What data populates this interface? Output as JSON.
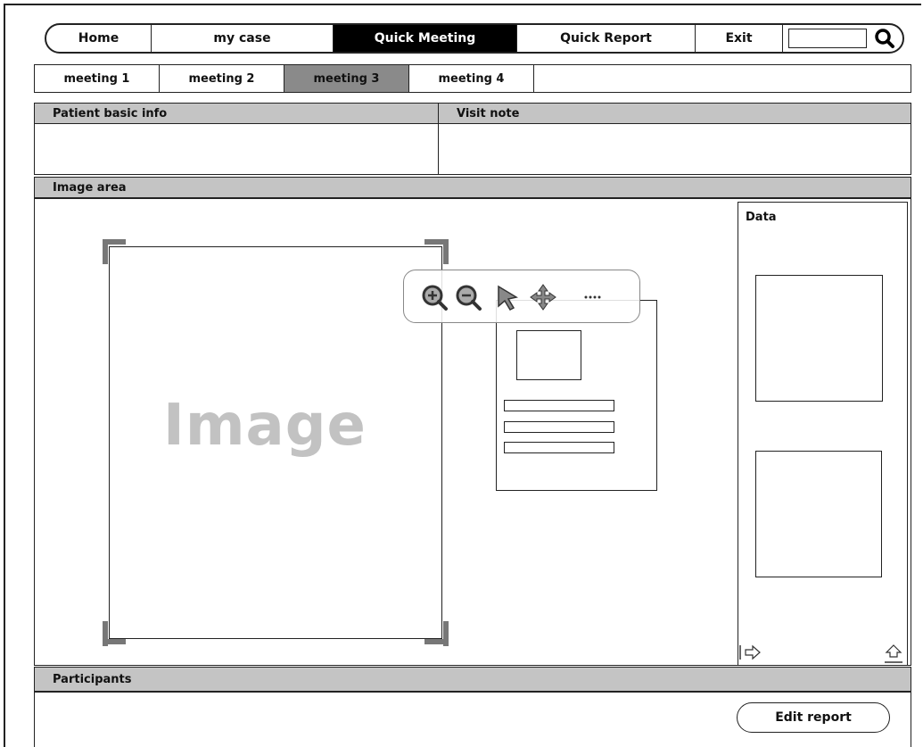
{
  "nav": {
    "items": [
      {
        "label": "Home"
      },
      {
        "label": "my case"
      },
      {
        "label": "Quick Meeting"
      },
      {
        "label": "Quick Report"
      },
      {
        "label": "Exit"
      }
    ],
    "active_index": 2,
    "search_value": ""
  },
  "tabs": {
    "items": [
      {
        "label": "meeting 1"
      },
      {
        "label": "meeting 2"
      },
      {
        "label": "meeting 3"
      },
      {
        "label": "meeting 4"
      }
    ],
    "active_index": 2
  },
  "panels": {
    "patient_info": "Patient basic info",
    "visit_note": "Visit note",
    "image_area": "Image area",
    "participants": "Participants",
    "data": "Data"
  },
  "image": {
    "placeholder": "Image"
  },
  "toolbar": {
    "tools": [
      "zoom-in-icon",
      "zoom-out-icon",
      "pointer-icon",
      "move-icon",
      "more-icon"
    ]
  },
  "actions": {
    "edit_report": "Edit report"
  },
  "colors": {
    "active_nav": "#000000",
    "active_tab": "#8a8a8a",
    "panel_header": "#c4c4c4",
    "placeholder_text": "#c2c2c2"
  }
}
